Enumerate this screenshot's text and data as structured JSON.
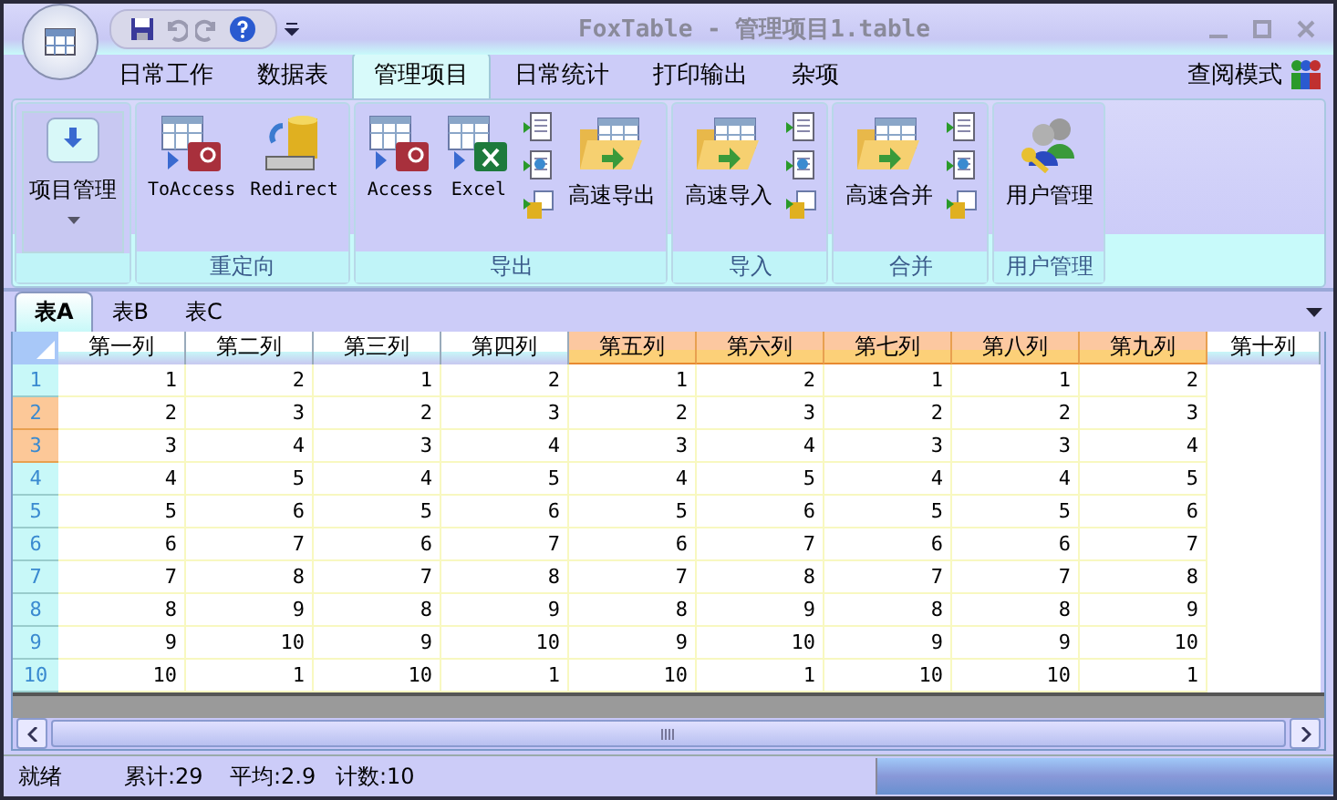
{
  "window": {
    "title": "FoxTable - 管理项目1.table"
  },
  "menu_tabs": [
    {
      "label": "日常工作",
      "selected": false
    },
    {
      "label": "数据表",
      "selected": false
    },
    {
      "label": "管理项目",
      "selected": true
    },
    {
      "label": "日常统计",
      "selected": false
    },
    {
      "label": "打印输出",
      "selected": false
    },
    {
      "label": "杂项",
      "selected": false
    }
  ],
  "view_mode": "查阅模式",
  "ribbon_groups": [
    {
      "buttons": [
        {
          "kind": "dropdown",
          "label": "项目管理"
        }
      ]
    },
    {
      "label": "重定向",
      "buttons": [
        {
          "kind": "access",
          "label": "ToAccess"
        },
        {
          "kind": "database",
          "label": "Redirect"
        }
      ]
    },
    {
      "label": "导出",
      "buttons": [
        {
          "kind": "access",
          "label": "Access"
        },
        {
          "kind": "excel",
          "label": "Excel"
        },
        {
          "kind": "small"
        },
        {
          "kind": "folder",
          "label": "高速导出"
        }
      ]
    },
    {
      "label": "导入",
      "buttons": [
        {
          "kind": "folder",
          "label": "高速导入"
        },
        {
          "kind": "small"
        }
      ]
    },
    {
      "label": "合并",
      "buttons": [
        {
          "kind": "folder",
          "label": "高速合并"
        },
        {
          "kind": "small"
        }
      ]
    },
    {
      "label": "用户管理",
      "buttons": [
        {
          "kind": "users",
          "label": "用户管理"
        }
      ]
    }
  ],
  "sheet_tabs": [
    {
      "label": "表A",
      "selected": true
    },
    {
      "label": "表B",
      "selected": false
    },
    {
      "label": "表C",
      "selected": false
    }
  ],
  "grid": {
    "columns": [
      {
        "label": "第一列",
        "selected": false
      },
      {
        "label": "第二列",
        "selected": false
      },
      {
        "label": "第三列",
        "selected": false
      },
      {
        "label": "第四列",
        "selected": false
      },
      {
        "label": "第五列",
        "selected": true
      },
      {
        "label": "第六列",
        "selected": true
      },
      {
        "label": "第七列",
        "selected": true
      },
      {
        "label": "第八列",
        "selected": true
      },
      {
        "label": "第九列",
        "selected": true
      },
      {
        "label": "第十列",
        "selected": false
      }
    ],
    "rows": [
      {
        "header": "1",
        "selected": false,
        "cells": [
          "1",
          "2",
          "1",
          "2",
          "1",
          "2",
          "1",
          "1",
          "2"
        ]
      },
      {
        "header": "2",
        "selected": true,
        "cells": [
          "2",
          "3",
          "2",
          "3",
          "2",
          "3",
          "2",
          "2",
          "3"
        ]
      },
      {
        "header": "3",
        "selected": true,
        "cells": [
          "3",
          "4",
          "3",
          "4",
          "3",
          "4",
          "3",
          "3",
          "4"
        ]
      },
      {
        "header": "4",
        "selected": false,
        "cells": [
          "4",
          "5",
          "4",
          "5",
          "4",
          "5",
          "4",
          "4",
          "5"
        ]
      },
      {
        "header": "5",
        "selected": false,
        "cells": [
          "5",
          "6",
          "5",
          "6",
          "5",
          "6",
          "5",
          "5",
          "6"
        ]
      },
      {
        "header": "6",
        "selected": false,
        "cells": [
          "6",
          "7",
          "6",
          "7",
          "6",
          "7",
          "6",
          "6",
          "7"
        ]
      },
      {
        "header": "7",
        "selected": false,
        "cells": [
          "7",
          "8",
          "7",
          "8",
          "7",
          "8",
          "7",
          "7",
          "8"
        ]
      },
      {
        "header": "8",
        "selected": false,
        "cells": [
          "8",
          "9",
          "8",
          "9",
          "8",
          "9",
          "8",
          "8",
          "9"
        ]
      },
      {
        "header": "9",
        "selected": false,
        "cells": [
          "9",
          "10",
          "9",
          "10",
          "9",
          "10",
          "9",
          "9",
          "10"
        ]
      },
      {
        "header": "10",
        "selected": false,
        "cells": [
          "10",
          "1",
          "10",
          "1",
          "10",
          "1",
          "10",
          "10",
          "1"
        ]
      }
    ]
  },
  "status_bar": [
    "就绪",
    "累计:29",
    "平均:2.9",
    "计数:10"
  ]
}
